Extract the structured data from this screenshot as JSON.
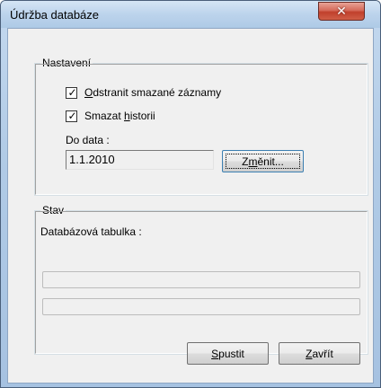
{
  "window": {
    "title": "Údržba databáze",
    "close_glyph": "✕"
  },
  "settings": {
    "legend": "Nastavení",
    "checkbox_delete_records": {
      "checked": true,
      "accel": "O",
      "rest": "dstranit smazané záznamy"
    },
    "checkbox_delete_history": {
      "checked": true,
      "before": "Smazat ",
      "accel": "h",
      "after": "istorii"
    },
    "date_label": "Do data :",
    "date_value": "1.1.2010",
    "change_button": {
      "before": "Z",
      "accel": "m",
      "after": "ěnit..."
    }
  },
  "status": {
    "legend": "Stav",
    "table_label": "Databázová tabulka :",
    "progress1_value": 0,
    "progress2_value": 0
  },
  "footer": {
    "run_button": {
      "accel": "S",
      "rest": "pustit"
    },
    "close_button": {
      "accel": "Z",
      "rest": "avřít"
    }
  }
}
